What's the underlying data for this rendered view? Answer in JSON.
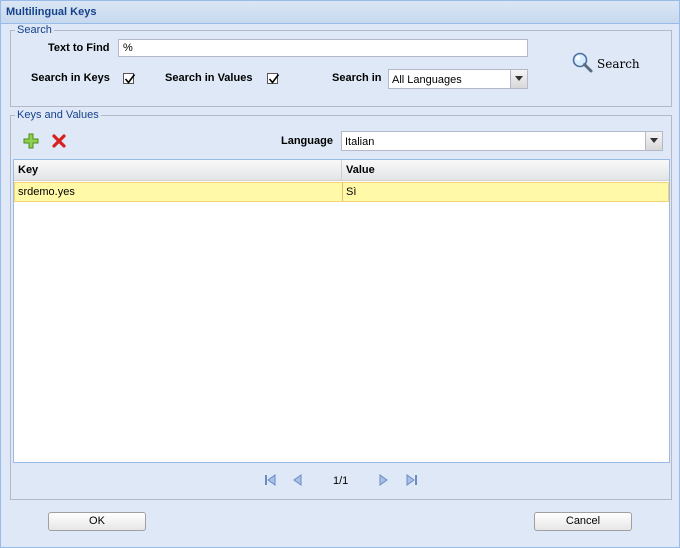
{
  "window": {
    "title": "Multilingual Keys"
  },
  "search": {
    "legend": "Search",
    "text_to_find_label": "Text to Find",
    "text_to_find_value": "%",
    "search_in_keys_label": "Search in Keys",
    "search_in_keys_checked": true,
    "search_in_values_label": "Search in Values",
    "search_in_values_checked": true,
    "search_in_label": "Search in",
    "search_in_value": "All Languages",
    "search_button_label": "Search"
  },
  "keys_values": {
    "legend": "Keys and Values",
    "language_label": "Language",
    "language_value": "Italian",
    "columns": [
      "Key",
      "Value"
    ],
    "rows": [
      {
        "key": "srdemo.yes",
        "value": "Sì"
      }
    ],
    "pager": {
      "page": "1/1"
    }
  },
  "footer": {
    "ok_label": "OK",
    "cancel_label": "Cancel"
  },
  "icons": {
    "add": "add-icon",
    "delete": "delete-icon",
    "search": "magnifier-icon",
    "first": "first-page-icon",
    "prev": "prev-page-icon",
    "next": "next-page-icon",
    "last": "last-page-icon"
  },
  "colors": {
    "title": "#15428b",
    "panel": "#dfe8f6",
    "border": "#99bbe8",
    "selected_row": "#fff9a8"
  }
}
